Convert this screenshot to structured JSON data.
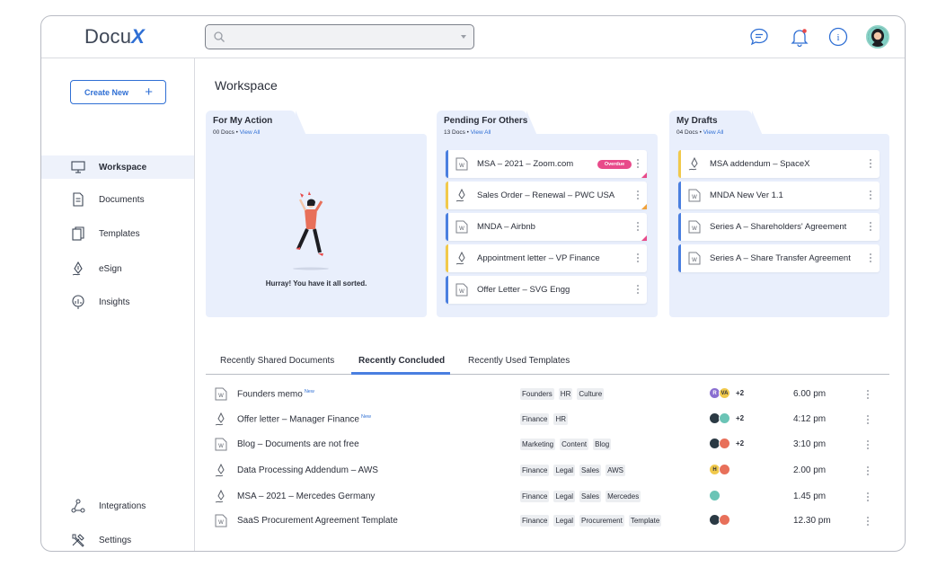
{
  "app": {
    "logo_text": "Docu",
    "logo_mark": "X"
  },
  "search": {
    "placeholder": "",
    "value": ""
  },
  "topbar": {
    "icons": [
      "chat-icon",
      "bell-icon",
      "info-icon",
      "avatar"
    ]
  },
  "sidebar": {
    "create_label": "Create New",
    "items": [
      {
        "label": "Workspace",
        "icon": "monitor-icon",
        "active": true
      },
      {
        "label": "Documents",
        "icon": "document-icon"
      },
      {
        "label": "Templates",
        "icon": "templates-icon"
      },
      {
        "label": "eSign",
        "icon": "pen-icon"
      },
      {
        "label": "Insights",
        "icon": "insights-icon"
      },
      {
        "label": "Integrations",
        "icon": "integrations-icon"
      },
      {
        "label": "Settings",
        "icon": "settings-icon"
      }
    ]
  },
  "main": {
    "title": "Workspace",
    "panels": {
      "my_action": {
        "title": "For My Action",
        "count": "00 Docs",
        "view_all": "View All",
        "empty_text": "Hurray! You have it all sorted."
      },
      "pending": {
        "title": "Pending For Others",
        "count": "13 Docs",
        "view_all": "View All",
        "items": [
          {
            "label": "MSA – 2021 – Zoom.com",
            "badge": "Overdue",
            "type": "doc"
          },
          {
            "label": "Sales Order – Renewal – PWC USA",
            "type": "sign"
          },
          {
            "label": "MNDA – Airbnb",
            "type": "doc"
          },
          {
            "label": "Appointment letter – VP Finance",
            "type": "sign"
          },
          {
            "label": "Offer Letter – SVG Engg",
            "type": "doc"
          }
        ]
      },
      "drafts": {
        "title": "My Drafts",
        "count": "04 Docs",
        "view_all": "View All",
        "items": [
          {
            "label": "MSA addendum – SpaceX",
            "type": "sign"
          },
          {
            "label": "MNDA New Ver 1.1",
            "type": "doc"
          },
          {
            "label": "Series A – Shareholders' Agreement",
            "type": "doc"
          },
          {
            "label": "Series A – Share Transfer Agreement",
            "type": "doc"
          }
        ]
      }
    },
    "tabs": [
      "Recently Shared Documents",
      "Recently Concluded",
      "Recently Used Templates"
    ],
    "active_tab": "Recently Concluded",
    "rows": [
      {
        "name": "Founders memo",
        "new": "New",
        "tags": [
          "Founders",
          "HR",
          "Culture"
        ],
        "avatars": [
          "R",
          "VA"
        ],
        "more": "+2",
        "time": "6.00 pm"
      },
      {
        "name": "Offer letter – Manager Finance",
        "new": "New",
        "tags": [
          "Finance",
          "HR"
        ],
        "avatars": [
          "",
          ""
        ],
        "more": "+2",
        "time": "4:12 pm"
      },
      {
        "name": "Blog – Documents are not free",
        "tags": [
          "Marketing",
          "Content",
          "Blog"
        ],
        "avatars": [
          "",
          ""
        ],
        "more": "+2",
        "time": "3:10 pm"
      },
      {
        "name": "Data Processing Addendum – AWS",
        "tags": [
          "Finance",
          "Legal",
          "Sales",
          "AWS"
        ],
        "avatars": [
          "H",
          ""
        ],
        "time": "2.00 pm"
      },
      {
        "name": "MSA – 2021 – Mercedes Germany",
        "tags": [
          "Finance",
          "Legal",
          "Sales",
          "Mercedes"
        ],
        "avatars": [
          ""
        ],
        "time": "1.45 pm"
      },
      {
        "name": "SaaS Procurement Agreement Template",
        "tags": [
          "Finance",
          "Legal",
          "Procurement",
          "Template"
        ],
        "avatars": [
          "",
          ""
        ],
        "time": "12.30 pm"
      }
    ]
  },
  "colors": {
    "accent": "#2f6fd4",
    "panel_bg": "#e9effc",
    "doc_stripe": "#4a7fe0",
    "sign_stripe": "#f1c94b",
    "overdue": "#e84a8a"
  }
}
